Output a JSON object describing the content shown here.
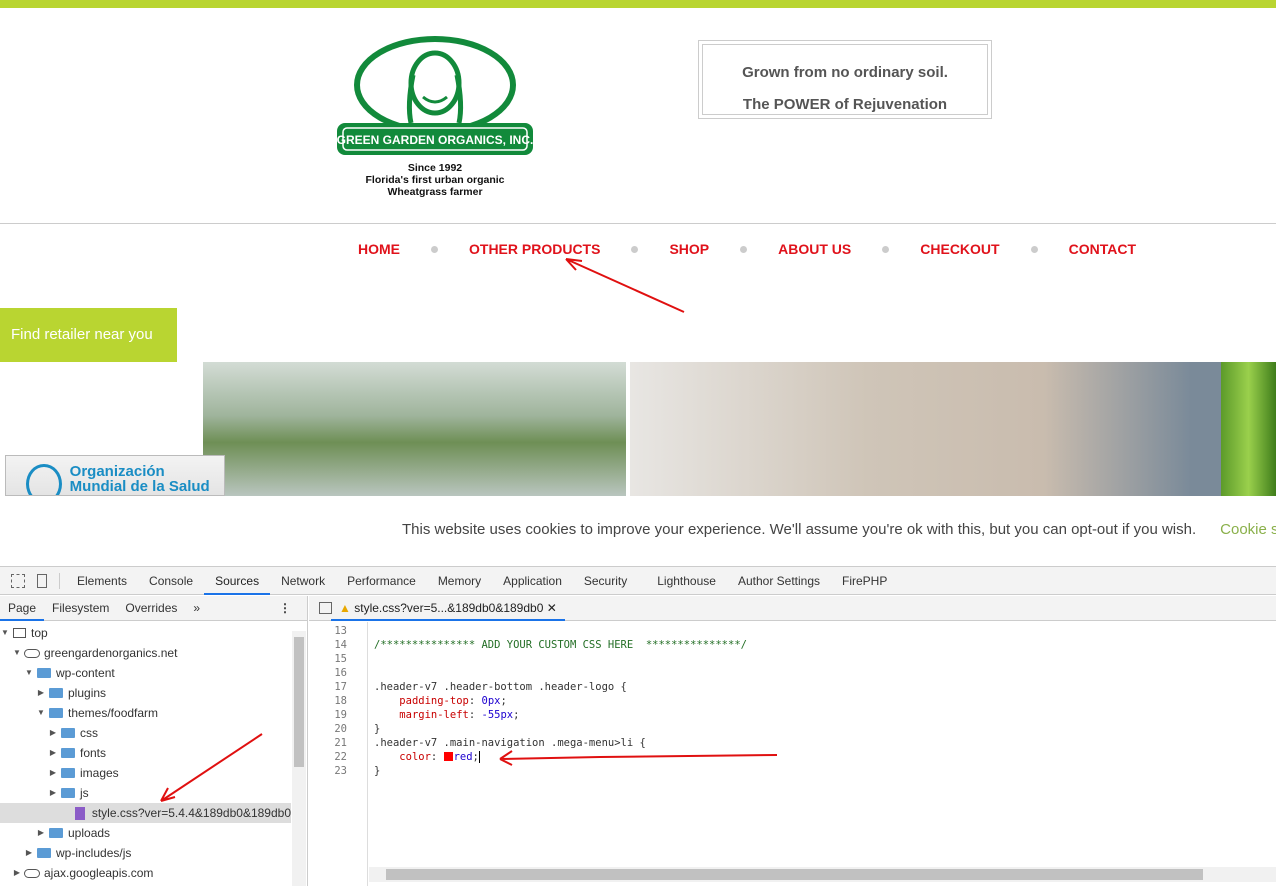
{
  "site": {
    "logo": {
      "name": "GREEN GARDEN ORGANICS, INC.",
      "since": "Since 1992",
      "line2": "Florida's first urban organic",
      "line3": "Wheatgrass farmer"
    },
    "tagline": [
      "Grown from no ordinary soil.",
      "The POWER of Rejuvenation"
    ],
    "nav": [
      "HOME",
      "OTHER PRODUCTS",
      "SHOP",
      "ABOUT US",
      "CHECKOUT",
      "CONTACT"
    ],
    "retailer_button": "Find retailer near you",
    "who_badge": "Organización Mundial de la Salud",
    "cookie_text": "This website uses cookies to improve your experience. We'll assume you're ok with this, but you can opt-out if you wish.",
    "cookie_link": "Cookie s",
    "colors": {
      "accent": "#b9d531",
      "nav": "#e0121b"
    }
  },
  "devtools": {
    "tabs": [
      "Elements",
      "Console",
      "Sources",
      "Network",
      "Performance",
      "Memory",
      "Application",
      "Security",
      "Lighthouse",
      "Author Settings",
      "FirePHP"
    ],
    "active_tab": "Sources",
    "left_tabs": [
      "Page",
      "Filesystem",
      "Overrides",
      "»"
    ],
    "tree": [
      {
        "label": "top",
        "depth": 0,
        "type": "frame",
        "open": true
      },
      {
        "label": "greengardenorganics.net",
        "depth": 1,
        "type": "cloud",
        "open": true
      },
      {
        "label": "wp-content",
        "depth": 2,
        "type": "folder",
        "open": true
      },
      {
        "label": "plugins",
        "depth": 3,
        "type": "folder",
        "open": false
      },
      {
        "label": "themes/foodfarm",
        "depth": 3,
        "type": "folder",
        "open": true
      },
      {
        "label": "css",
        "depth": 4,
        "type": "folder",
        "open": false
      },
      {
        "label": "fonts",
        "depth": 4,
        "type": "folder",
        "open": false
      },
      {
        "label": "images",
        "depth": 4,
        "type": "folder",
        "open": false
      },
      {
        "label": "js",
        "depth": 4,
        "type": "folder",
        "open": false
      },
      {
        "label": "style.css?ver=5.4.4&189db0&189db0",
        "depth": 5,
        "type": "file",
        "selected": true
      },
      {
        "label": "uploads",
        "depth": 3,
        "type": "folder",
        "open": false
      },
      {
        "label": "wp-includes/js",
        "depth": 2,
        "type": "folder",
        "open": false
      },
      {
        "label": "ajax.googleapis.com",
        "depth": 1,
        "type": "cloud",
        "open": false
      }
    ],
    "open_file": "style.css?ver=5...&189db0&189db0",
    "code": {
      "line_numbers": [
        "13",
        "14",
        "15",
        "16",
        "17",
        "18",
        "19",
        "20",
        "21",
        "22",
        "23"
      ],
      "comment": "/*************** ADD YOUR CUSTOM CSS HERE  ***************/",
      "sel1": ".header-v7 .header-bottom .header-logo {",
      "p1": "padding-top",
      "v1": "0px",
      "p2": "margin-left",
      "v2": "-55px",
      "close": "}",
      "sel2": ".header-v7 .main-navigation .mega-menu>li {",
      "p3": "color",
      "v3": "red"
    }
  }
}
